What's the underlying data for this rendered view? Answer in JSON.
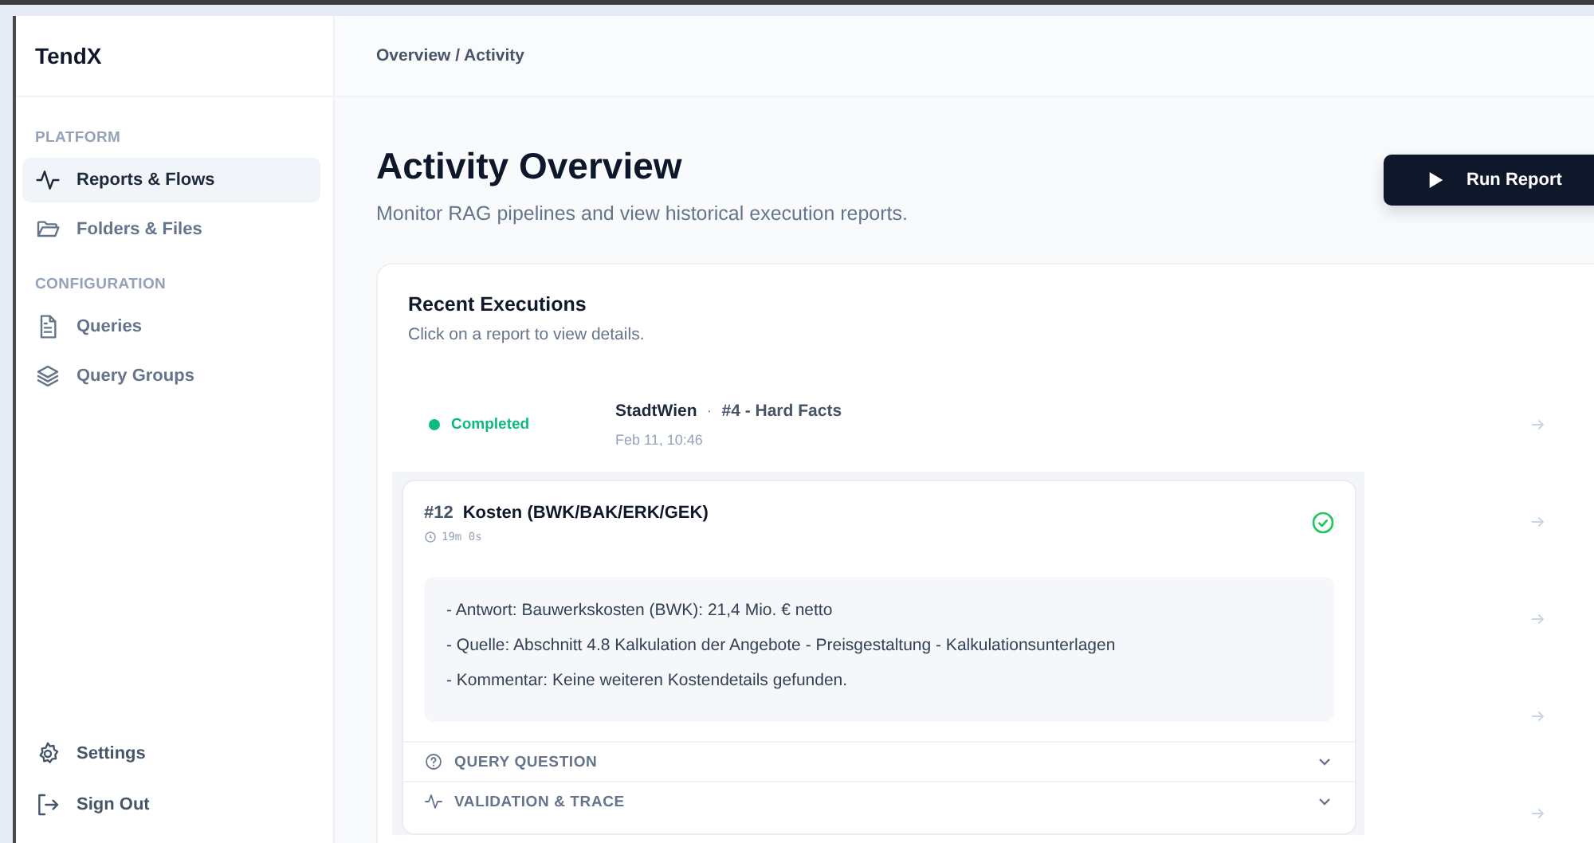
{
  "app": {
    "logo": "TendX"
  },
  "sidebar": {
    "sections": [
      {
        "heading": "PLATFORM",
        "items": [
          {
            "label": "Reports & Flows",
            "kind": "pulse",
            "selected": true
          },
          {
            "label": "Folders & Files",
            "kind": "folder",
            "selected": false
          }
        ]
      },
      {
        "heading": "CONFIGURATION",
        "items": [
          {
            "label": "Queries",
            "kind": "file",
            "selected": false
          },
          {
            "label": "Query Groups",
            "kind": "layers",
            "selected": false
          }
        ]
      }
    ],
    "footer": [
      {
        "label": "Settings",
        "kind": "settings"
      },
      {
        "label": "Sign Out",
        "kind": "signout"
      }
    ]
  },
  "breadcrumb": "Overview / Activity",
  "page": {
    "title": "Activity Overview",
    "subtitle": "Monitor RAG pipelines and view historical execution reports.",
    "run_button": "Run Report"
  },
  "executions": {
    "title": "Recent Executions",
    "subtitle": "Click on a report to view details.",
    "rows": [
      {
        "status": "Completed",
        "color": "#10b981",
        "project": "StadtWien",
        "separator": "·",
        "query": "#4 - Hard Facts",
        "date": "Feb 11, 10:46"
      }
    ]
  },
  "detail": {
    "number": "#12",
    "title": "Kosten (BWK/BAK/ERK/GEK)",
    "duration": "19m 0s",
    "done": true,
    "answer_lines": [
      "- Antwort: Bauwerkskosten (BWK): 21,4 Mio. € netto",
      "- Quelle: Abschnitt 4.8 Kalkulation der Angebote - Preisgestaltung - Kalkulationsunterlagen",
      "- Kommentar: Keine weiteren Kostendetails gefunden."
    ],
    "sections": [
      {
        "label": "QUERY QUESTION",
        "kind": "help",
        "expanded": false
      },
      {
        "label": "VALIDATION & TRACE",
        "kind": "pulse",
        "expanded": false
      }
    ]
  }
}
